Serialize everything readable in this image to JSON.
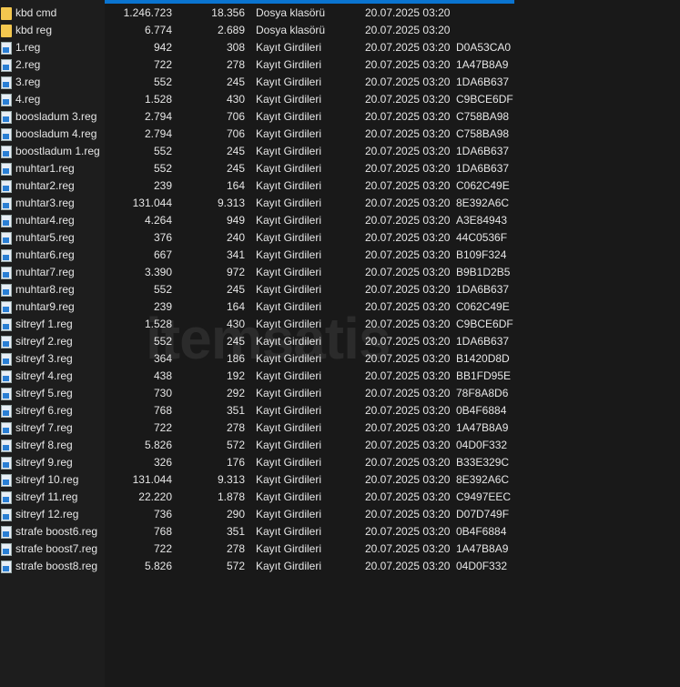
{
  "watermark": "itemsatis",
  "files": [
    {
      "name": "kbd cmd",
      "size": "1.246.723",
      "packed": "18.356",
      "type": "Dosya klasörü",
      "modified": "20.07.2025 03:20",
      "crc": "",
      "icon": "folder"
    },
    {
      "name": "kbd reg",
      "size": "6.774",
      "packed": "2.689",
      "type": "Dosya klasörü",
      "modified": "20.07.2025 03:20",
      "crc": "",
      "icon": "folder"
    },
    {
      "name": "1.reg",
      "size": "942",
      "packed": "308",
      "type": "Kayıt Girdileri",
      "modified": "20.07.2025 03:20",
      "crc": "D0A53CA0",
      "icon": "reg"
    },
    {
      "name": "2.reg",
      "size": "722",
      "packed": "278",
      "type": "Kayıt Girdileri",
      "modified": "20.07.2025 03:20",
      "crc": "1A47B8A9",
      "icon": "reg"
    },
    {
      "name": "3.reg",
      "size": "552",
      "packed": "245",
      "type": "Kayıt Girdileri",
      "modified": "20.07.2025 03:20",
      "crc": "1DA6B637",
      "icon": "reg"
    },
    {
      "name": "4.reg",
      "size": "1.528",
      "packed": "430",
      "type": "Kayıt Girdileri",
      "modified": "20.07.2025 03:20",
      "crc": "C9BCE6DF",
      "icon": "reg"
    },
    {
      "name": "boosladum 3.reg",
      "size": "2.794",
      "packed": "706",
      "type": "Kayıt Girdileri",
      "modified": "20.07.2025 03:20",
      "crc": "C758BA98",
      "icon": "reg"
    },
    {
      "name": "boosladum 4.reg",
      "size": "2.794",
      "packed": "706",
      "type": "Kayıt Girdileri",
      "modified": "20.07.2025 03:20",
      "crc": "C758BA98",
      "icon": "reg"
    },
    {
      "name": "boostladum 1.reg",
      "size": "552",
      "packed": "245",
      "type": "Kayıt Girdileri",
      "modified": "20.07.2025 03:20",
      "crc": "1DA6B637",
      "icon": "reg"
    },
    {
      "name": "muhtar1.reg",
      "size": "552",
      "packed": "245",
      "type": "Kayıt Girdileri",
      "modified": "20.07.2025 03:20",
      "crc": "1DA6B637",
      "icon": "reg"
    },
    {
      "name": "muhtar2.reg",
      "size": "239",
      "packed": "164",
      "type": "Kayıt Girdileri",
      "modified": "20.07.2025 03:20",
      "crc": "C062C49E",
      "icon": "reg"
    },
    {
      "name": "muhtar3.reg",
      "size": "131.044",
      "packed": "9.313",
      "type": "Kayıt Girdileri",
      "modified": "20.07.2025 03:20",
      "crc": "8E392A6C",
      "icon": "reg"
    },
    {
      "name": "muhtar4.reg",
      "size": "4.264",
      "packed": "949",
      "type": "Kayıt Girdileri",
      "modified": "20.07.2025 03:20",
      "crc": "A3E84943",
      "icon": "reg"
    },
    {
      "name": "muhtar5.reg",
      "size": "376",
      "packed": "240",
      "type": "Kayıt Girdileri",
      "modified": "20.07.2025 03:20",
      "crc": "44C0536F",
      "icon": "reg"
    },
    {
      "name": "muhtar6.reg",
      "size": "667",
      "packed": "341",
      "type": "Kayıt Girdileri",
      "modified": "20.07.2025 03:20",
      "crc": "B109F324",
      "icon": "reg"
    },
    {
      "name": "muhtar7.reg",
      "size": "3.390",
      "packed": "972",
      "type": "Kayıt Girdileri",
      "modified": "20.07.2025 03:20",
      "crc": "B9B1D2B5",
      "icon": "reg"
    },
    {
      "name": "muhtar8.reg",
      "size": "552",
      "packed": "245",
      "type": "Kayıt Girdileri",
      "modified": "20.07.2025 03:20",
      "crc": "1DA6B637",
      "icon": "reg"
    },
    {
      "name": "muhtar9.reg",
      "size": "239",
      "packed": "164",
      "type": "Kayıt Girdileri",
      "modified": "20.07.2025 03:20",
      "crc": "C062C49E",
      "icon": "reg"
    },
    {
      "name": "sitreyf 1.reg",
      "size": "1.528",
      "packed": "430",
      "type": "Kayıt Girdileri",
      "modified": "20.07.2025 03:20",
      "crc": "C9BCE6DF",
      "icon": "reg"
    },
    {
      "name": "sitreyf 2.reg",
      "size": "552",
      "packed": "245",
      "type": "Kayıt Girdileri",
      "modified": "20.07.2025 03:20",
      "crc": "1DA6B637",
      "icon": "reg"
    },
    {
      "name": "sitreyf 3.reg",
      "size": "364",
      "packed": "186",
      "type": "Kayıt Girdileri",
      "modified": "20.07.2025 03:20",
      "crc": "B1420D8D",
      "icon": "reg"
    },
    {
      "name": "sitreyf 4.reg",
      "size": "438",
      "packed": "192",
      "type": "Kayıt Girdileri",
      "modified": "20.07.2025 03:20",
      "crc": "BB1FD95E",
      "icon": "reg"
    },
    {
      "name": "sitreyf 5.reg",
      "size": "730",
      "packed": "292",
      "type": "Kayıt Girdileri",
      "modified": "20.07.2025 03:20",
      "crc": "78F8A8D6",
      "icon": "reg"
    },
    {
      "name": "sitreyf 6.reg",
      "size": "768",
      "packed": "351",
      "type": "Kayıt Girdileri",
      "modified": "20.07.2025 03:20",
      "crc": "0B4F6884",
      "icon": "reg"
    },
    {
      "name": "sitreyf 7.reg",
      "size": "722",
      "packed": "278",
      "type": "Kayıt Girdileri",
      "modified": "20.07.2025 03:20",
      "crc": "1A47B8A9",
      "icon": "reg"
    },
    {
      "name": "sitreyf 8.reg",
      "size": "5.826",
      "packed": "572",
      "type": "Kayıt Girdileri",
      "modified": "20.07.2025 03:20",
      "crc": "04D0F332",
      "icon": "reg"
    },
    {
      "name": "sitreyf 9.reg",
      "size": "326",
      "packed": "176",
      "type": "Kayıt Girdileri",
      "modified": "20.07.2025 03:20",
      "crc": "B33E329C",
      "icon": "reg"
    },
    {
      "name": "sitreyf 10.reg",
      "size": "131.044",
      "packed": "9.313",
      "type": "Kayıt Girdileri",
      "modified": "20.07.2025 03:20",
      "crc": "8E392A6C",
      "icon": "reg"
    },
    {
      "name": "sitreyf 11.reg",
      "size": "22.220",
      "packed": "1.878",
      "type": "Kayıt Girdileri",
      "modified": "20.07.2025 03:20",
      "crc": "C9497EEC",
      "icon": "reg"
    },
    {
      "name": "sitreyf 12.reg",
      "size": "736",
      "packed": "290",
      "type": "Kayıt Girdileri",
      "modified": "20.07.2025 03:20",
      "crc": "D07D749F",
      "icon": "reg"
    },
    {
      "name": "strafe boost6.reg",
      "size": "768",
      "packed": "351",
      "type": "Kayıt Girdileri",
      "modified": "20.07.2025 03:20",
      "crc": "0B4F6884",
      "icon": "reg"
    },
    {
      "name": "strafe boost7.reg",
      "size": "722",
      "packed": "278",
      "type": "Kayıt Girdileri",
      "modified": "20.07.2025 03:20",
      "crc": "1A47B8A9",
      "icon": "reg"
    },
    {
      "name": "strafe boost8.reg",
      "size": "5.826",
      "packed": "572",
      "type": "Kayıt Girdileri",
      "modified": "20.07.2025 03:20",
      "crc": "04D0F332",
      "icon": "reg"
    }
  ]
}
